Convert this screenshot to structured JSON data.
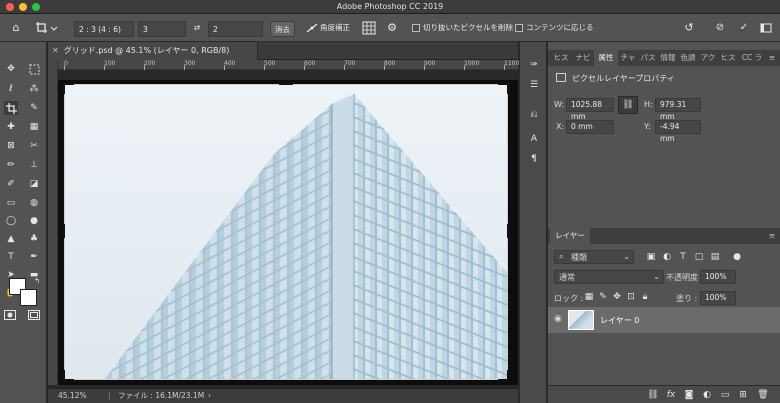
{
  "window": {
    "title": "Adobe Photoshop CC 2019"
  },
  "options": {
    "ratio_preset": "2 : 3 (4 : 6)",
    "width_value": "3",
    "height_value": "2",
    "clear_label": "消去",
    "straighten_label": "角度補正",
    "delete_cropped_label": "切り抜いたピクセルを削除",
    "content_aware_label": "コンテンツに応じる"
  },
  "document": {
    "tab_label": "グリッド.psd @ 45.1% (レイヤー 0, RGB/8)",
    "zoom": "45.12%",
    "file_size": "ファイル : 16.1M/23.1M"
  },
  "ruler": {
    "marks": [
      "0",
      "100",
      "200",
      "300",
      "400",
      "500",
      "600",
      "700",
      "800",
      "900",
      "1000",
      "1100"
    ]
  },
  "panel": {
    "tabs": [
      "ヒス",
      "ナビ",
      "属性",
      "チャ",
      "パス",
      "情報",
      "色調",
      "アク",
      "ヒス",
      "CC ラ"
    ],
    "active_tab_index": 2,
    "properties_title": "ピクセルレイヤープロパティ",
    "w_label": "W:",
    "w_value": "1025.88 mm",
    "h_label": "H:",
    "h_value": "979.31 mm",
    "x_label": "X:",
    "x_value": "0 mm",
    "y_label": "Y:",
    "y_value": "-4.94 mm"
  },
  "layers": {
    "tab_label": "レイヤー",
    "filter_kind": "種類",
    "blend_mode": "通常",
    "opacity_label": "不透明度 :",
    "opacity_value": "100%",
    "lock_label": "ロック :",
    "fill_label": "塗り :",
    "fill_value": "100%",
    "items": [
      {
        "name": "レイヤー 0",
        "visible": true
      }
    ]
  },
  "bottom_icons": [
    "fx"
  ]
}
